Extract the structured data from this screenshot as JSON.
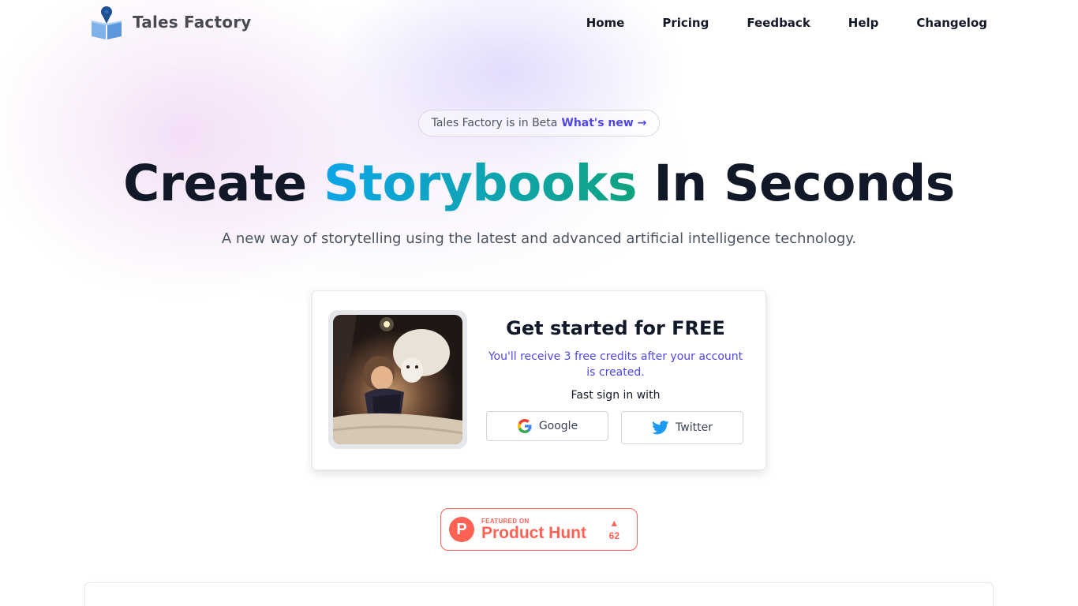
{
  "brand": {
    "name": "Tales Factory",
    "logo": "book-pin-logo-icon"
  },
  "nav": {
    "items": [
      {
        "label": "Home"
      },
      {
        "label": "Pricing"
      },
      {
        "label": "Feedback"
      },
      {
        "label": "Help"
      },
      {
        "label": "Changelog"
      }
    ]
  },
  "beta": {
    "text": "Tales Factory is in Beta",
    "link": "What's new →"
  },
  "hero": {
    "title_part1": "Create",
    "title_highlight": "Storybooks",
    "title_part2": "In Seconds",
    "subtitle": "A new way of storytelling using the latest and advanced artificial intelligence technology."
  },
  "signup_card": {
    "title": "Get started for FREE",
    "note": "You'll receive 3 free credits after your account is created.",
    "signin_label": "Fast sign in with",
    "google_label": "Google",
    "twitter_label": "Twitter"
  },
  "product_hunt": {
    "featured": "FEATURED ON",
    "name": "Product Hunt",
    "votes": "62"
  },
  "colors": {
    "accent": "#4f46e5",
    "gradient_start": "#0ea5e9",
    "gradient_end": "#10a37f",
    "product_hunt": "#ff6154",
    "twitter": "#1d9bf0"
  }
}
